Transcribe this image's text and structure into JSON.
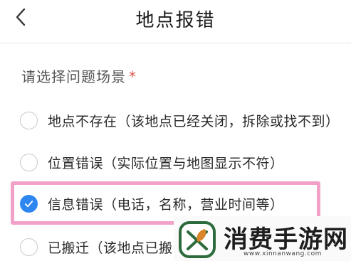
{
  "header": {
    "title": "地点报错",
    "back_icon": "chevron-left-icon"
  },
  "form": {
    "question_label": "请选择问题场景",
    "required_mark": "*",
    "options": [
      {
        "label": "地点不存在（该地点已经关闭，拆除或找不到）",
        "checked": false
      },
      {
        "label": "位置错误（实际位置与地图显示不符）",
        "checked": false
      },
      {
        "label": "信息错误（电话，名称，营业时间等）",
        "checked": true
      },
      {
        "label": "已搬迁（该地点已搬",
        "checked": false
      }
    ]
  },
  "watermark": {
    "title": "消费手游网",
    "url": "www.xinnanwang.com"
  },
  "colors": {
    "accent": "#2e87f0",
    "highlight": "#f2a0c8",
    "required": "#e0524a",
    "watermark_logo": "#2d6b3c"
  }
}
